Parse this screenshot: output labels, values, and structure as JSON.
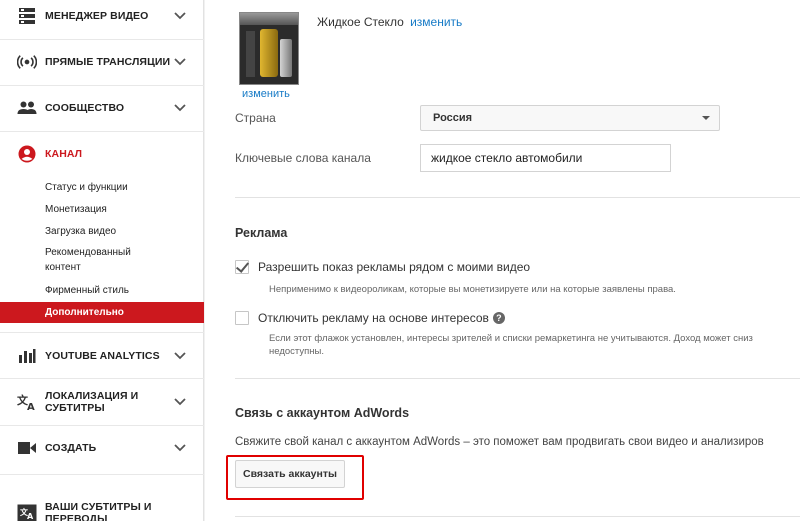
{
  "sidebar": {
    "items": [
      {
        "label": "МЕНЕДЖЕР ВИДЕО",
        "icon": "video-manager-icon"
      },
      {
        "label": "ПРЯМЫЕ ТРАНСЛЯЦИИ",
        "icon": "live-broadcast-icon"
      },
      {
        "label": "СООБЩЕСТВО",
        "icon": "community-icon"
      },
      {
        "label": "КАНАЛ",
        "icon": "channel-user-icon",
        "active": true
      },
      {
        "label": "YOUTUBE ANALYTICS",
        "icon": "analytics-icon"
      },
      {
        "label": "ЛОКАЛИЗАЦИЯ И СУБТИТРЫ",
        "label_line1": "ЛОКАЛИЗАЦИЯ И",
        "label_line2": "СУБТИТРЫ",
        "icon": "translate-icon"
      },
      {
        "label": "СОЗДАТЬ",
        "icon": "create-camera-icon"
      },
      {
        "label": "ВАШИ СУБТИТРЫ И ПЕРЕВОДЫ",
        "label_line1": "ВАШИ СУБТИТРЫ И",
        "label_line2": "ПЕРЕВОДЫ",
        "icon": "subtitles-icon"
      }
    ],
    "channel_subitems": [
      {
        "label": "Статус и функции"
      },
      {
        "label": "Монетизация"
      },
      {
        "label": "Загрузка видео"
      },
      {
        "label": "Рекомендованный контент",
        "label_line1": "Рекомендованный",
        "label_line2": "контент"
      },
      {
        "label": "Фирменный стиль"
      },
      {
        "label": "Дополнительно",
        "selected": true
      }
    ],
    "accent_color": "#cc181e"
  },
  "main": {
    "thumbnail_change_link": "изменить",
    "channel_name": "Жидкое Стекло",
    "channel_name_change_link": "изменить",
    "country": {
      "label": "Страна",
      "value": "Россия"
    },
    "keywords": {
      "label": "Ключевые слова канала",
      "value": "жидкое стекло автомобили"
    },
    "ads": {
      "title": "Реклама",
      "options": [
        {
          "label": "Разрешить показ рекламы рядом с моими видео",
          "checked": true,
          "note": "Неприменимо к видеороликам, которые вы монетизируете или на которые заявлены права."
        },
        {
          "label": "Отключить рекламу на основе интересов",
          "checked": false,
          "has_help": true,
          "help_glyph": "?",
          "note_line1": "Если этот флажок установлен, интересы зрителей и списки ремаркетинга не учитываются. Доход может сниз",
          "note_line2": "недоступны."
        }
      ]
    },
    "adwords": {
      "title": "Связь с аккаунтом AdWords",
      "description": "Свяжите свой канал с аккаунтом AdWords – это поможет вам продвигать свои видео и анализиров",
      "button_label": "Связать аккаунты",
      "highlight_color": "#e00000"
    },
    "link_color": "#167ac6"
  }
}
